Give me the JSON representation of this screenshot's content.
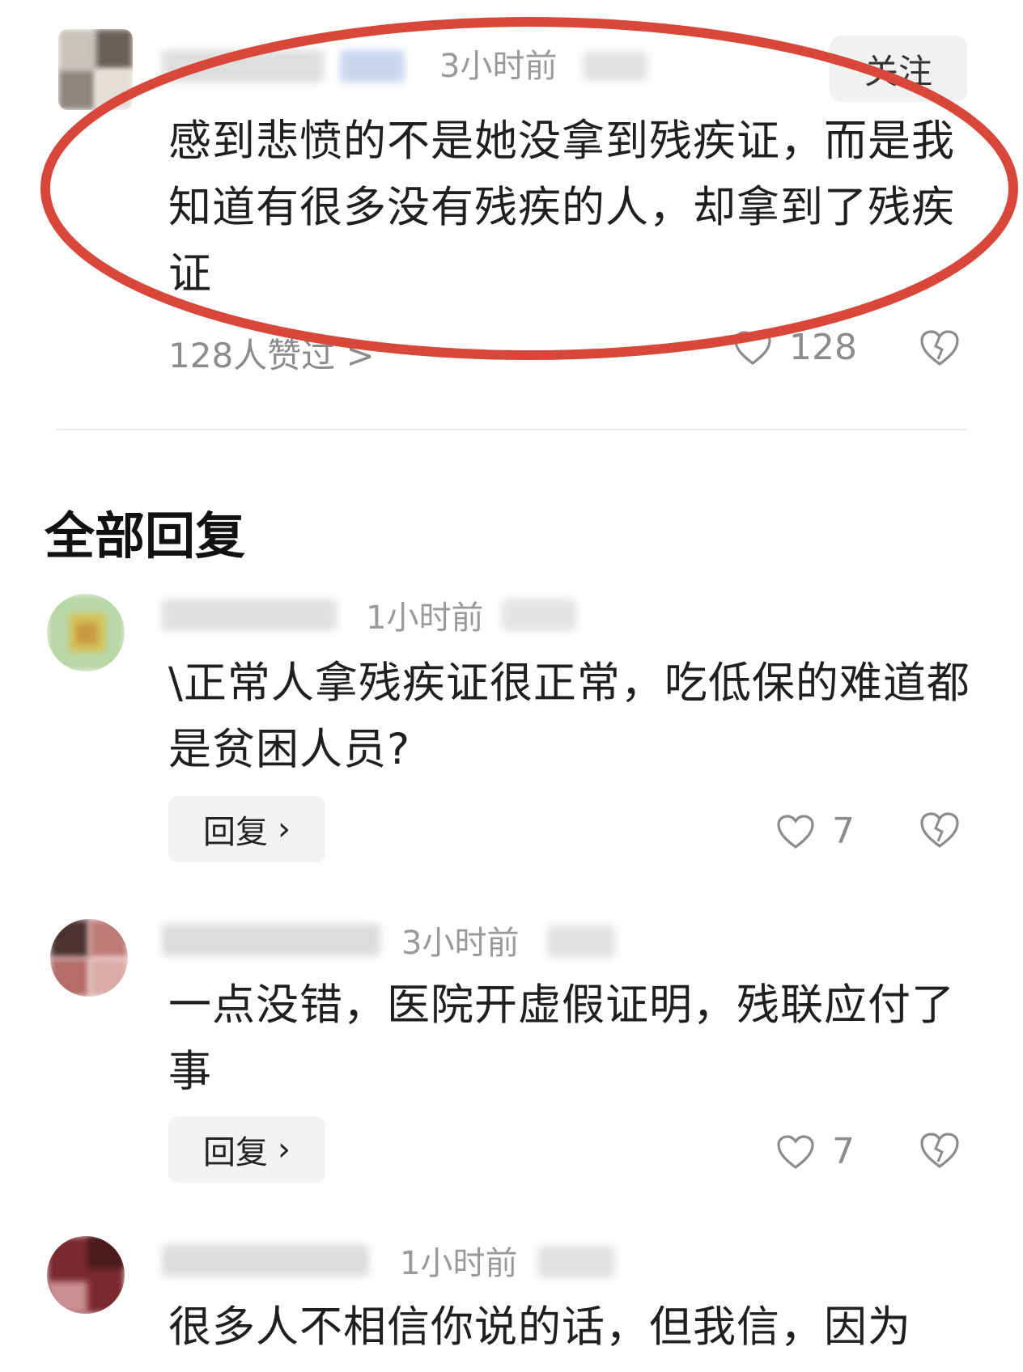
{
  "top_comment": {
    "time": "3小时前",
    "follow_label": "关注",
    "text": "感到悲愤的不是她没拿到残疾证，而是我知道有很多没有残疾的人，却拿到了残疾证",
    "likes_summary": "128人赞过 >",
    "like_count": "128"
  },
  "section_title": "全部回复",
  "replies": [
    {
      "time": "1小时前",
      "text": "\\正常人拿残疾证很正常，吃低保的难道都是贫困人员?",
      "reply_label": "回复",
      "like_count": "7"
    },
    {
      "time": "3小时前",
      "text": "一点没错，医院开虚假证明，残联应付了事",
      "reply_label": "回复",
      "like_count": "7"
    },
    {
      "time": "1小时前",
      "text": "很多人不相信你说的话，但我信，因为"
    }
  ],
  "colors": {
    "annotation_circle": "#d8473a",
    "muted_text": "#9a9a9a",
    "button_bg": "#f3f3f3"
  },
  "icons": {
    "like": "heart-outline-icon",
    "dislike": "broken-heart-icon",
    "chevron": "chevron-right-icon"
  }
}
